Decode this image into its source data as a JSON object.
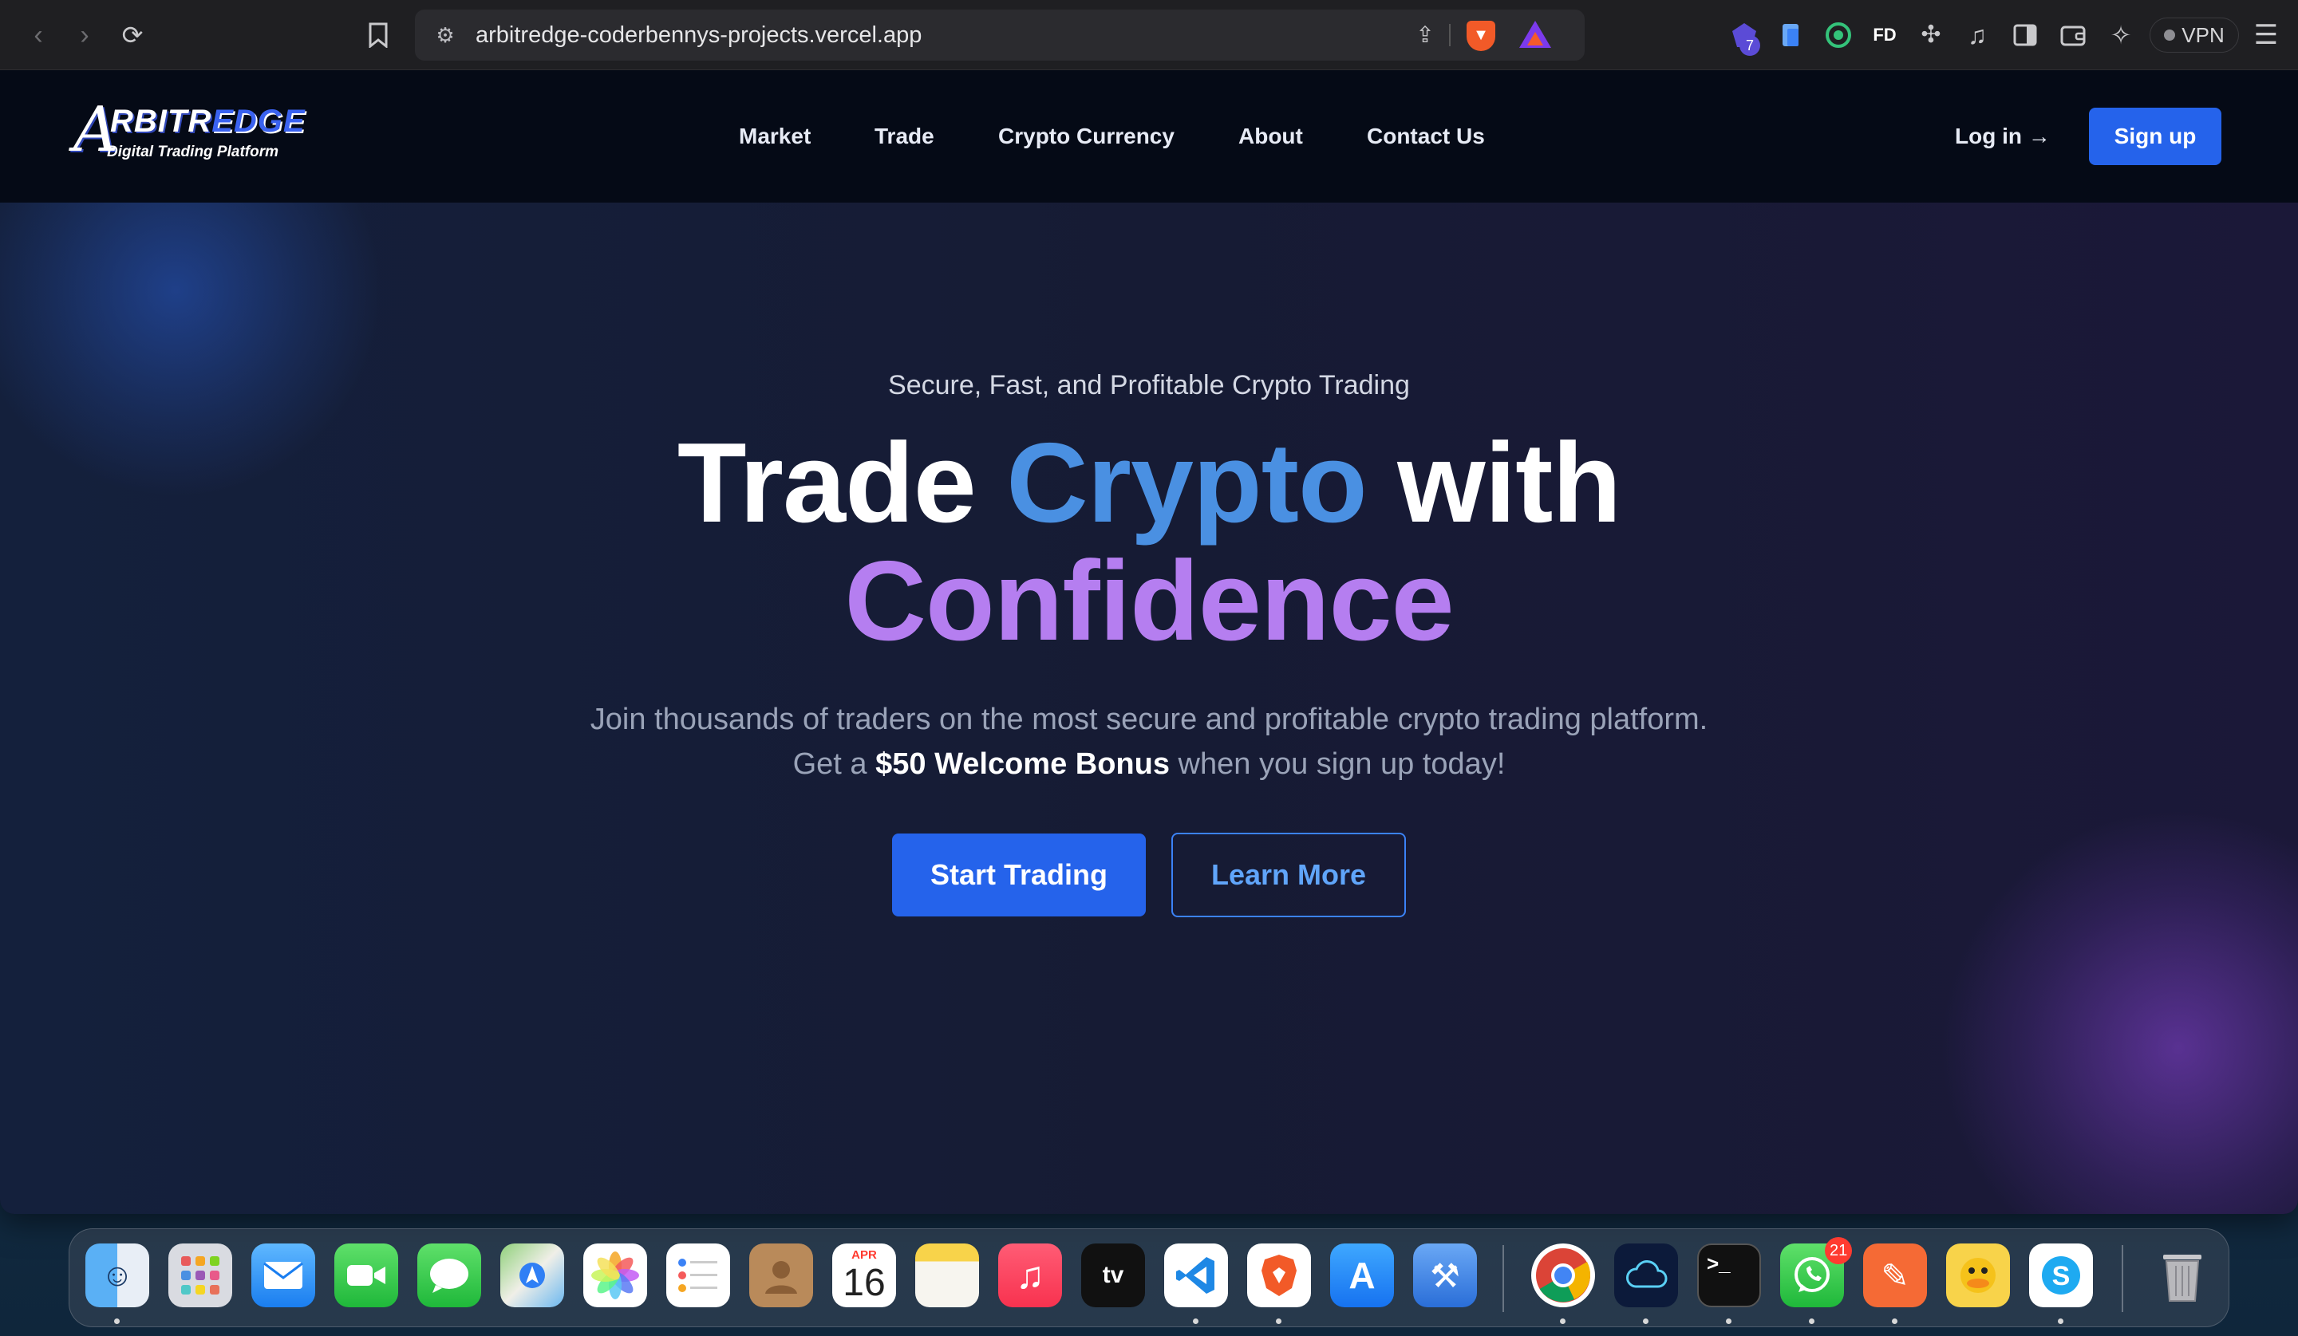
{
  "browser": {
    "url": "arbitredge-coderbennys-projects.vercel.app",
    "extension_badge": "7",
    "vpn_label": "VPN"
  },
  "site": {
    "logo": {
      "initial": "A",
      "main_a": "RBITR",
      "main_b": "EDGE",
      "subtitle": "Digital Trading Platform"
    },
    "nav": [
      {
        "label": "Market"
      },
      {
        "label": "Trade"
      },
      {
        "label": "Crypto Currency"
      },
      {
        "label": "About"
      },
      {
        "label": "Contact Us"
      }
    ],
    "login_label": "Log in →",
    "signup_label": "Sign up"
  },
  "hero": {
    "tagline": "Secure, Fast, and Profitable Crypto Trading",
    "headline_1": "Trade ",
    "headline_2": "Crypto",
    "headline_3": " with",
    "headline_4": "Confidence",
    "subtext_line1": "Join thousands of traders on the most secure and profitable crypto trading platform.",
    "subtext_line2_pre": "Get a ",
    "subtext_line2_bold": "$50 Welcome Bonus",
    "subtext_line2_post": " when you sign up today!",
    "start_label": "Start Trading",
    "learn_label": "Learn More"
  },
  "colors": {
    "accent_blue": "#2563eb",
    "headline_blue": "#4a90e2",
    "headline_purple": "#b57ef0"
  },
  "dock": {
    "calendar_month": "APR",
    "calendar_day": "16",
    "whatsapp_badge": "21",
    "apps": [
      "finder-icon",
      "launchpad-icon",
      "mail-icon",
      "facetime-icon",
      "messages-icon",
      "maps-icon",
      "photos-icon",
      "reminders-icon",
      "contacts-icon",
      "calendar-icon",
      "notes-icon",
      "music-icon",
      "apple-tv-icon",
      "vscode-icon",
      "brave-icon",
      "app-store-icon",
      "xcode-icon",
      "chrome-icon",
      "cloud-app-icon",
      "terminal-icon",
      "whatsapp-icon",
      "postman-icon",
      "cyberduck-icon",
      "skype-icon",
      "trash-icon"
    ]
  }
}
